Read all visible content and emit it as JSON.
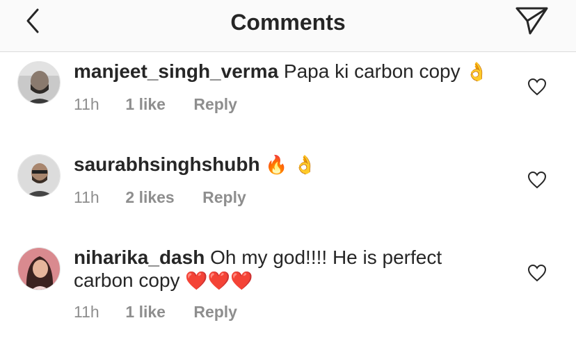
{
  "header": {
    "title": "Comments"
  },
  "comments": [
    {
      "username": "manjeet_singh_verma",
      "text": "Papa ki carbon copy",
      "emojis": "👌",
      "time": "11h",
      "likes": "1 like",
      "reply": "Reply"
    },
    {
      "username": "saurabhsinghshubh",
      "text": "",
      "emojis": "🔥 👌",
      "time": "11h",
      "likes": "2 likes",
      "reply": "Reply"
    },
    {
      "username": "niharika_dash",
      "text": "Oh my god!!!! He is perfect carbon copy",
      "emojis": "❤️❤️❤️",
      "time": "11h",
      "likes": "1 like",
      "reply": "Reply"
    }
  ],
  "colors": {
    "muted": "#8e8e8e",
    "text": "#262626",
    "heart_emoji": "#e0245e"
  }
}
